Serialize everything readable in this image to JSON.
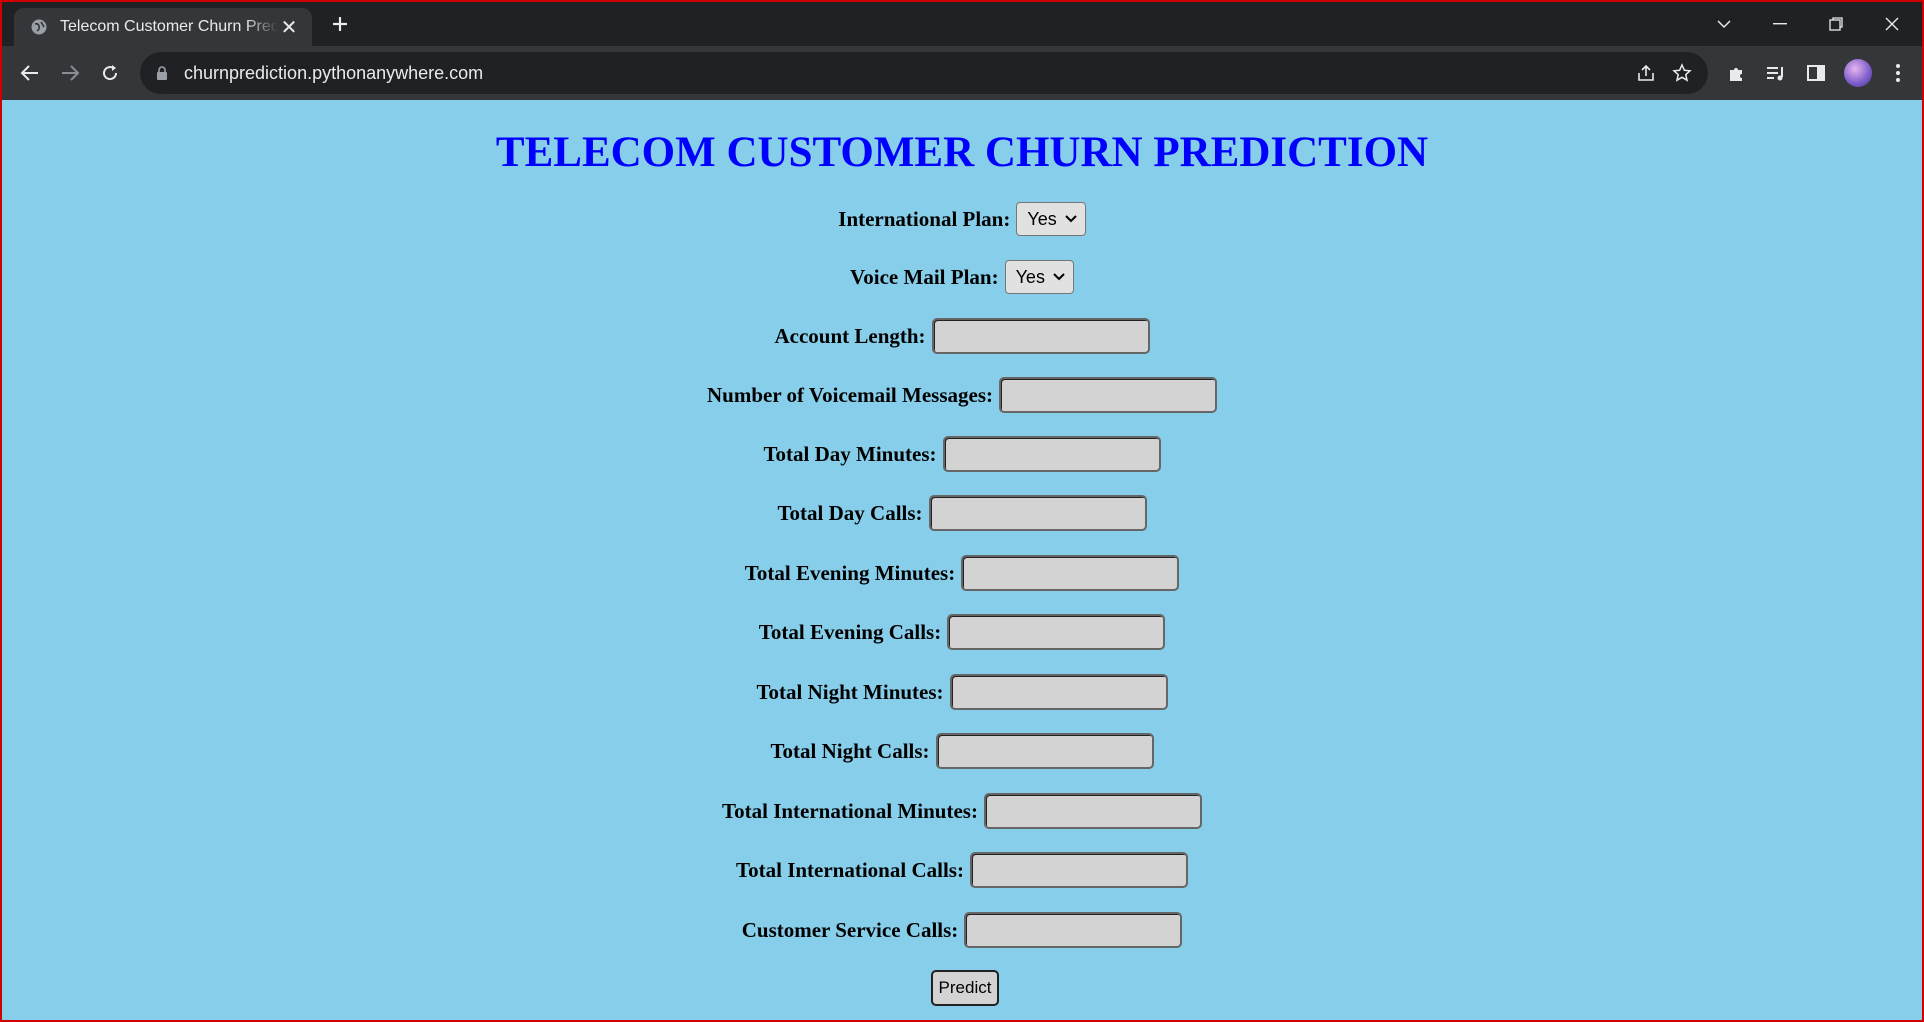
{
  "browser": {
    "tab_title": "Telecom Customer Churn Prediction",
    "url": "churnprediction.pythonanywhere.com"
  },
  "page": {
    "heading": "TELECOM CUSTOMER CHURN PREDICTION",
    "international_plan": {
      "label": "International Plan:",
      "selected": "Yes"
    },
    "voice_mail_plan": {
      "label": "Voice Mail Plan:",
      "selected": "Yes"
    },
    "fields": [
      {
        "label": "Account Length:",
        "value": ""
      },
      {
        "label": "Number of Voicemail Messages:",
        "value": ""
      },
      {
        "label": "Total Day Minutes:",
        "value": ""
      },
      {
        "label": "Total Day Calls:",
        "value": ""
      },
      {
        "label": "Total Evening Minutes:",
        "value": ""
      },
      {
        "label": "Total Evening Calls:",
        "value": ""
      },
      {
        "label": "Total Night Minutes:",
        "value": ""
      },
      {
        "label": "Total Night Calls:",
        "value": ""
      },
      {
        "label": "Total International Minutes:",
        "value": ""
      },
      {
        "label": "Total International Calls:",
        "value": ""
      },
      {
        "label": "Customer Service Calls:",
        "value": ""
      }
    ],
    "predict_label": "Predict"
  },
  "colors": {
    "page_background": "#87ceeb",
    "heading": "#0000ff",
    "input_background": "#d3d3d3"
  }
}
